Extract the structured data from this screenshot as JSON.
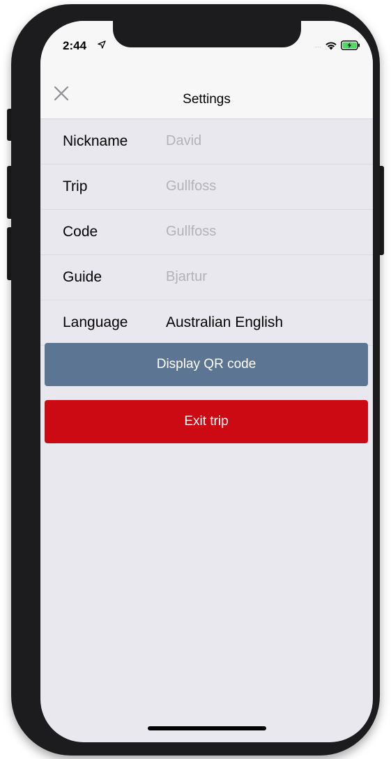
{
  "status_bar": {
    "time": "2:44",
    "signal": "....",
    "location_icon": "location-arrow-icon",
    "wifi_icon": "wifi-icon",
    "battery_icon": "battery-charging-icon",
    "battery_color": "#4cd964"
  },
  "nav": {
    "close_icon": "close-icon",
    "title": "Settings"
  },
  "settings": {
    "rows": [
      {
        "label": "Nickname",
        "value": "David"
      },
      {
        "label": "Trip",
        "value": "Gullfoss"
      },
      {
        "label": "Code",
        "value": "Gullfoss"
      },
      {
        "label": "Guide",
        "value": "Bjartur"
      },
      {
        "label": "Language",
        "value": "Australian English"
      }
    ]
  },
  "actions": {
    "qr_label": "Display QR code",
    "qr_color": "#5c7593",
    "exit_label": "Exit trip",
    "exit_color": "#cc0a14"
  }
}
